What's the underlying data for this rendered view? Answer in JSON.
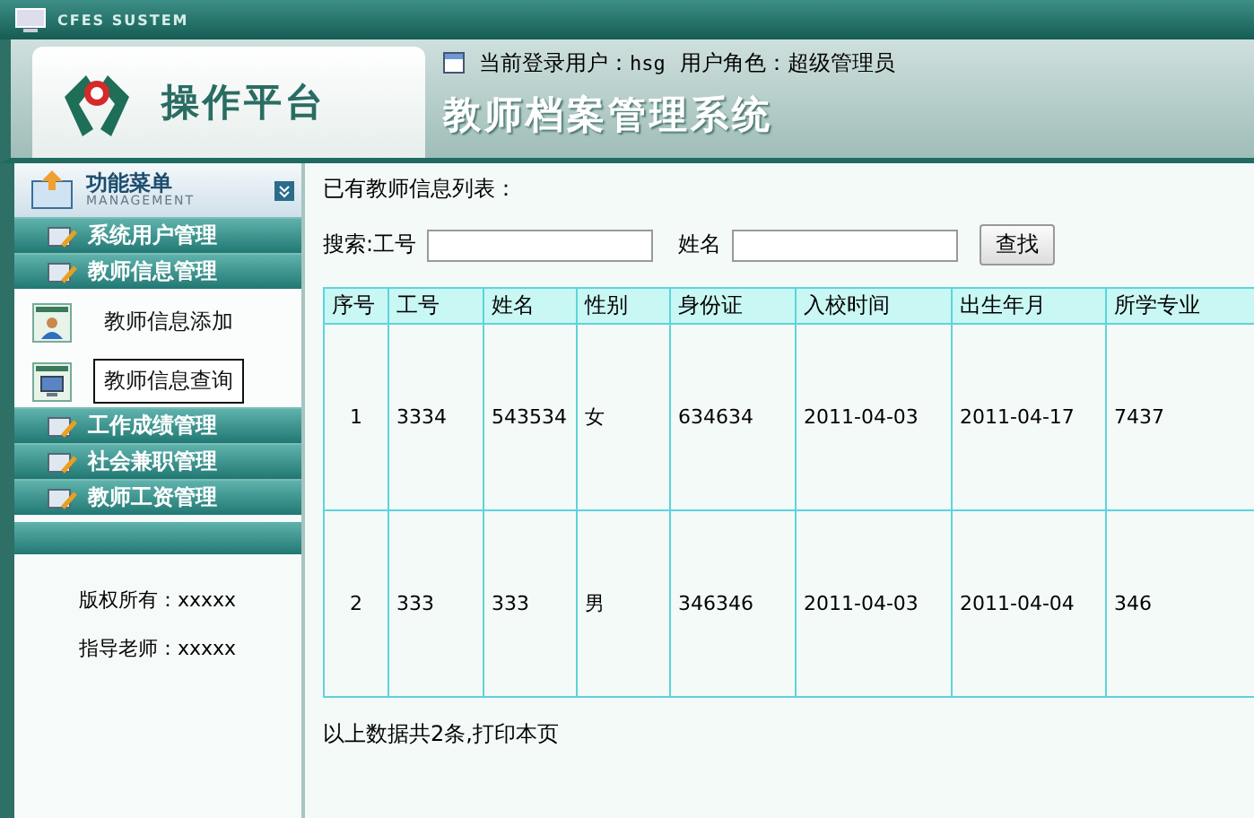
{
  "window": {
    "title": "CFES SUSTEM"
  },
  "header": {
    "platform": "操作平台",
    "user_label": "当前登录用户：",
    "user": "hsg",
    "role_label": "用户角色：",
    "role": "超级管理员",
    "system_title": "教师档案管理系统"
  },
  "sidebar": {
    "title": "功能菜单",
    "subtitle": "MANAGEMENT",
    "items": [
      {
        "label": "系统用户管理"
      },
      {
        "label": "教师信息管理",
        "children": [
          {
            "label": "教师信息添加",
            "kind": "add",
            "selected": false
          },
          {
            "label": "教师信息查询",
            "kind": "query",
            "selected": true
          }
        ]
      },
      {
        "label": "工作成绩管理"
      },
      {
        "label": "社会兼职管理"
      },
      {
        "label": "教师工资管理"
      }
    ],
    "footer": [
      "版权所有：xxxxx",
      "指导老师：xxxxx"
    ]
  },
  "content": {
    "heading": "已有教师信息列表：",
    "search_label": "搜索:工号",
    "name_label": "姓名",
    "search_button": "查找",
    "table": {
      "columns": [
        "序号",
        "工号",
        "姓名",
        "性别",
        "身份证",
        "入校时间",
        "出生年月",
        "所学专业"
      ],
      "rows": [
        [
          "1",
          "3334",
          "543534",
          "女",
          "634634",
          "2011-04-03",
          "2011-04-17",
          "7437"
        ],
        [
          "2",
          "333",
          "333",
          "男",
          "346346",
          "2011-04-03",
          "2011-04-04",
          "346"
        ]
      ]
    },
    "summary": "以上数据共2条,打印本页"
  }
}
